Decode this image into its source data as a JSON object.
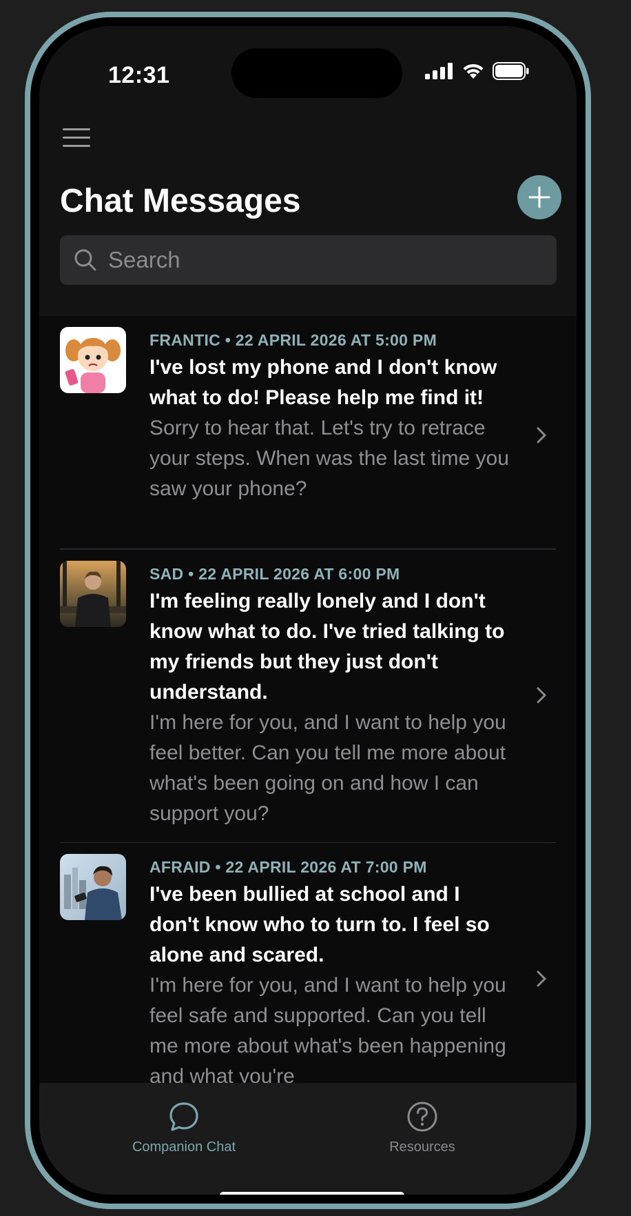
{
  "status_bar": {
    "time": "12:31"
  },
  "header": {
    "title": "Chat Messages"
  },
  "search": {
    "placeholder": "Search"
  },
  "chats": [
    {
      "meta": "FRANTIC • 22 APRIL 2026 AT 5:00 PM",
      "message": "I've lost my phone and I don't know what to do! Please help me find it!",
      "reply": "Sorry to hear that. Let's try to retrace your steps. When was the last time you saw your phone?"
    },
    {
      "meta": "SAD • 22 APRIL 2026 AT 6:00 PM",
      "message": "I'm feeling really lonely and I don't know what to do. I've tried talking to my friends but they just don't understand.",
      "reply": "I'm here for you, and I want to help you feel better. Can you tell me more about what's been going on and how I can support you?"
    },
    {
      "meta": "AFRAID • 22 APRIL 2026 AT 7:00 PM",
      "message": "I've been bullied at school and I don't know who to turn to. I feel so alone and scared.",
      "reply": "I'm here for you, and I want to help you feel safe and supported. Can you tell me more about what's been happening and what you're"
    }
  ],
  "tabbar": {
    "tabs": [
      {
        "label": "Companion Chat",
        "icon": "chat-bubble-icon",
        "active": true
      },
      {
        "label": "Resources",
        "icon": "question-circle-icon",
        "active": false
      }
    ]
  },
  "colors": {
    "accent": "#6e9aa1",
    "meta": "#8fb2b8",
    "frame": "#7ba3aa"
  }
}
